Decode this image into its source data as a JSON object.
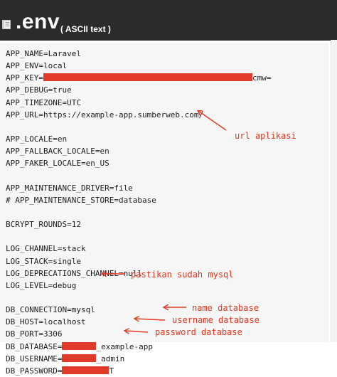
{
  "header": {
    "title": ".env",
    "subtitle": "( ASCII text )",
    "icon": "book-icon"
  },
  "code_lines": [
    {
      "key": "app_name",
      "parts": [
        {
          "t": "APP_NAME=Laravel"
        }
      ]
    },
    {
      "key": "app_env",
      "parts": [
        {
          "t": "APP_ENV=local"
        }
      ]
    },
    {
      "key": "app_key",
      "parts": [
        {
          "t": "APP_KEY="
        },
        {
          "redact": true,
          "w": 294
        },
        {
          "t": "cmw="
        }
      ]
    },
    {
      "key": "app_debug",
      "parts": [
        {
          "t": "APP_DEBUG=true"
        }
      ]
    },
    {
      "key": "app_timezone",
      "parts": [
        {
          "t": "APP_TIMEZONE=UTC"
        }
      ]
    },
    {
      "key": "app_url",
      "parts": [
        {
          "t": "APP_URL=https://example-app.sumberweb.com/"
        }
      ]
    },
    {
      "key": "blank_1",
      "parts": []
    },
    {
      "key": "app_locale",
      "parts": [
        {
          "t": "APP_LOCALE=en"
        }
      ]
    },
    {
      "key": "app_fallback_locale",
      "parts": [
        {
          "t": "APP_FALLBACK_LOCALE=en"
        }
      ]
    },
    {
      "key": "app_faker_locale",
      "parts": [
        {
          "t": "APP_FAKER_LOCALE=en_US"
        }
      ]
    },
    {
      "key": "blank_2",
      "parts": []
    },
    {
      "key": "app_maintenance_driver",
      "parts": [
        {
          "t": "APP_MAINTENANCE_DRIVER=file"
        }
      ]
    },
    {
      "key": "app_maintenance_store",
      "parts": [
        {
          "t": "# APP_MAINTENANCE_STORE=database"
        }
      ]
    },
    {
      "key": "blank_3",
      "parts": []
    },
    {
      "key": "bcrypt_rounds",
      "parts": [
        {
          "t": "BCRYPT_ROUNDS=12"
        }
      ]
    },
    {
      "key": "blank_4",
      "parts": []
    },
    {
      "key": "log_channel",
      "parts": [
        {
          "t": "LOG_CHANNEL=stack"
        }
      ]
    },
    {
      "key": "log_stack",
      "parts": [
        {
          "t": "LOG_STACK=single"
        }
      ]
    },
    {
      "key": "log_deprecations_channel",
      "parts": [
        {
          "t": "LOG_DEPRECATIONS_CHANNEL=null"
        }
      ]
    },
    {
      "key": "log_level",
      "parts": [
        {
          "t": "LOG_LEVEL=debug"
        }
      ]
    },
    {
      "key": "blank_5",
      "parts": []
    },
    {
      "key": "db_connection",
      "parts": [
        {
          "t": "DB_CONNECTION=mysql"
        }
      ]
    },
    {
      "key": "db_host",
      "parts": [
        {
          "t": "DB_HOST=localhost"
        }
      ]
    },
    {
      "key": "db_port",
      "parts": [
        {
          "t": "DB_PORT=3306"
        }
      ]
    },
    {
      "key": "db_database",
      "parts": [
        {
          "t": "DB_DATABASE="
        },
        {
          "redact": true,
          "w": 48
        },
        {
          "t": "_example-app"
        }
      ]
    },
    {
      "key": "db_username",
      "parts": [
        {
          "t": "DB_USERNAME="
        },
        {
          "redact": true,
          "w": 48
        },
        {
          "t": "_admin"
        }
      ]
    },
    {
      "key": "db_password",
      "parts": [
        {
          "t": "DB_PASSWORD="
        },
        {
          "redact": true,
          "w": 66
        },
        {
          "t": "T"
        }
      ]
    }
  ],
  "annotations": {
    "url": "url aplikasi",
    "mysql": "pastikan sudah mysql",
    "db_name": "name database",
    "db_user": "username database",
    "db_pass": "password database"
  },
  "colors": {
    "annotation": "#e0391e",
    "redaction": "#e23a2a",
    "header_bg": "#2b2b2b",
    "code_bg": "#f6f6f6"
  }
}
